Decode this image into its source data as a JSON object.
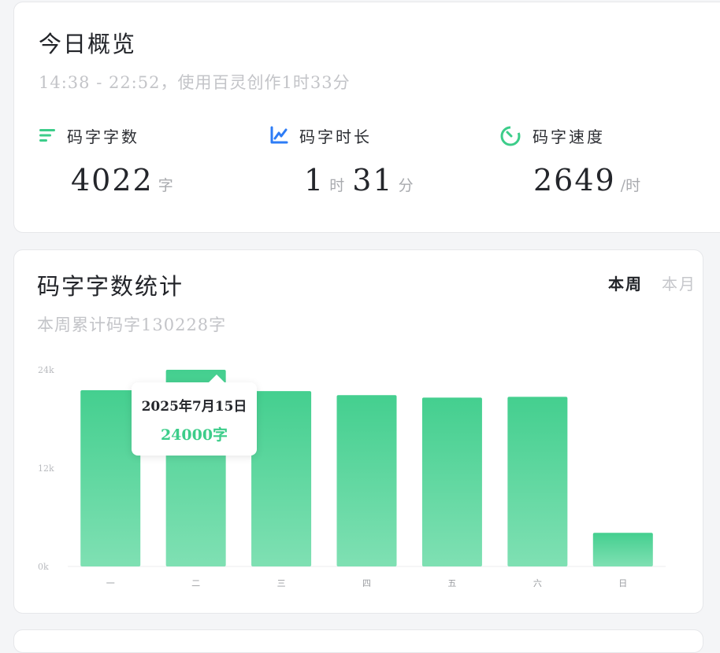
{
  "overview": {
    "title": "今日概览",
    "subtitle": "14:38 - 22:52，使用百灵创作1时33分",
    "metrics": [
      {
        "icon": "bars-icon",
        "label": "码字字数",
        "value": "4022",
        "unit": "字"
      },
      {
        "icon": "line-chart-icon",
        "label": "码字时长",
        "value_h": "1",
        "unit_h": "时",
        "value_m": "31",
        "unit_m": "分"
      },
      {
        "icon": "timer-icon",
        "label": "码字速度",
        "value": "2649",
        "unit": "/时"
      }
    ]
  },
  "stats": {
    "title": "码字字数统计",
    "subtitle": "本周累计码字130228字",
    "tabs": [
      {
        "label": "本周",
        "active": true
      },
      {
        "label": "本月",
        "active": false
      }
    ],
    "tooltip": {
      "date": "2025年7月15日",
      "value": "24000字"
    }
  },
  "colors": {
    "green": "#3ccd8a",
    "blue": "#2d7cf6",
    "bar_top": "#44cf8f",
    "bar_bottom": "#7fe0b3"
  },
  "chart_data": {
    "type": "bar",
    "categories": [
      "一",
      "二",
      "三",
      "四",
      "五",
      "六",
      "日"
    ],
    "values": [
      21500,
      24000,
      21400,
      20900,
      20600,
      20700,
      4100
    ],
    "ylim": [
      0,
      24000
    ],
    "yticks": [
      "0k",
      "12k",
      "24k"
    ],
    "ytick_values": [
      0,
      12000,
      24000
    ],
    "highlight_index": 1
  }
}
